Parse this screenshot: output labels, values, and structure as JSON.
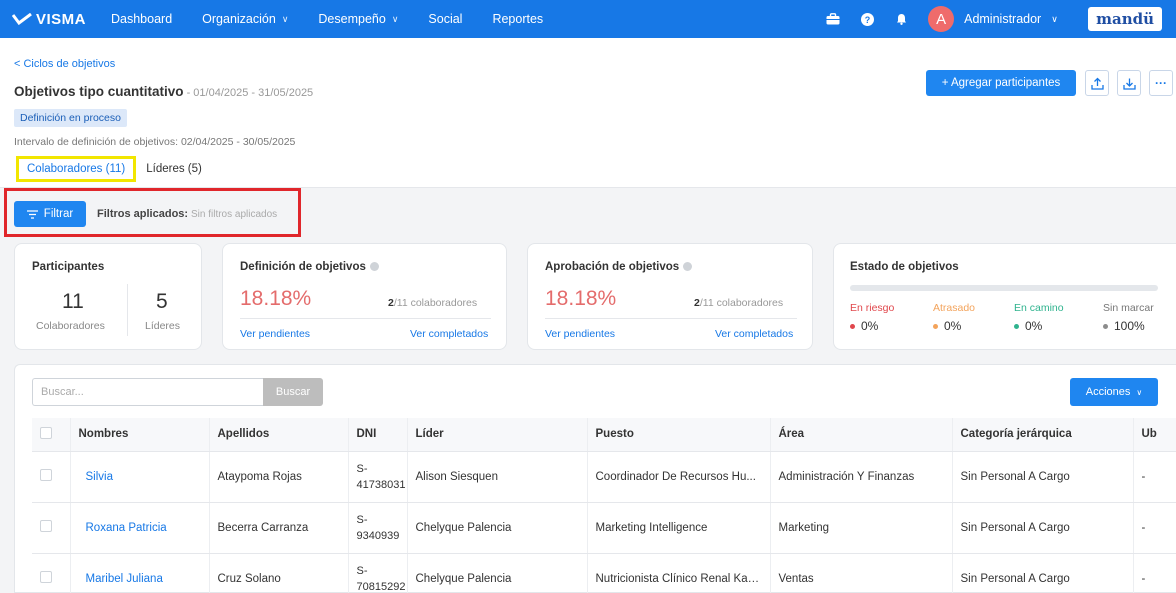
{
  "topnav": {
    "brand": "VISMA",
    "items": [
      {
        "label": "Dashboard",
        "dropdown": false
      },
      {
        "label": "Organización",
        "dropdown": true
      },
      {
        "label": "Desempeño",
        "dropdown": true
      },
      {
        "label": "Social",
        "dropdown": false
      },
      {
        "label": "Reportes",
        "dropdown": false
      }
    ],
    "avatar_initial": "A",
    "user_name": "Administrador",
    "product_logo": "mandü",
    "icons": [
      "briefcase-icon",
      "help-icon",
      "bell-icon"
    ]
  },
  "header": {
    "back_link": "< Ciclos de objetivos",
    "title": "Objetivos tipo cuantitativo",
    "dates": " - 01/04/2025 - 31/05/2025",
    "status": "Definición en proceso",
    "interval": "Intervalo de definición de objetivos: 02/04/2025 - 30/05/2025",
    "tabs": [
      {
        "label": "Colaboradores (11)",
        "active": true
      },
      {
        "label": "Líderes (5)",
        "active": false
      }
    ],
    "add_button": "+ Agregar participantes",
    "more": "···"
  },
  "filters": {
    "button": "Filtrar",
    "label": "Filtros aplicados:",
    "value": "Sin filtros aplicados"
  },
  "cards": {
    "participants": {
      "title": "Participantes",
      "collaborators_count": "11",
      "collaborators_label": "Colaboradores",
      "leaders_count": "5",
      "leaders_label": "Líderes"
    },
    "definition": {
      "title": "Definición de objetivos",
      "percent": "18.18%",
      "done": "2",
      "total_text": "/11 colaboradores",
      "pending_link": "Ver pendientes",
      "completed_link": "Ver completados"
    },
    "approval": {
      "title": "Aprobación de objetivos",
      "percent": "18.18%",
      "done": "2",
      "total_text": "/11 colaboradores",
      "pending_link": "Ver pendientes",
      "completed_link": "Ver completados"
    },
    "status": {
      "title": "Estado de objetivos",
      "states": [
        {
          "label": "En riesgo",
          "value": "0%",
          "color": "#e0474c"
        },
        {
          "label": "Atrasado",
          "value": "0%",
          "color": "#f3a35b"
        },
        {
          "label": "En camino",
          "value": "0%",
          "color": "#2fb38e"
        },
        {
          "label": "Sin marcar",
          "value": "100%",
          "color": "#8c8c8c"
        }
      ]
    }
  },
  "table_panel": {
    "search_placeholder": "Buscar...",
    "search_button": "Buscar",
    "actions_button": "Acciones",
    "columns": [
      "Nombres",
      "Apellidos",
      "DNI",
      "Líder",
      "Puesto",
      "Área",
      "Categoría jerárquica",
      "Ub"
    ],
    "rows": [
      {
        "nombres": "Silvia",
        "apellidos": "Ataypoma Rojas",
        "dni_prefix": "S-",
        "dni": "41738031",
        "lider": "Alison Siesquen",
        "puesto": "Coordinador De Recursos Hu...",
        "area": "Administración Y Finanzas",
        "categoria": "Sin Personal A Cargo",
        "ub": "-"
      },
      {
        "nombres": "Roxana Patricia",
        "apellidos": "Becerra Carranza",
        "dni_prefix": "S-",
        "dni": "9340939",
        "lider": "Chelyque Palencia",
        "puesto": "Marketing Intelligence",
        "area": "Marketing",
        "categoria": "Sin Personal A Cargo",
        "ub": "-"
      },
      {
        "nombres": "Maribel Juliana",
        "apellidos": "Cruz Solano",
        "dni_prefix": "S-",
        "dni": "70815292",
        "lider": "Chelyque Palencia",
        "puesto": "Nutricionista Clínico Renal Kab...",
        "area": "Ventas",
        "categoria": "Sin Personal A Cargo",
        "ub": "-"
      }
    ]
  }
}
